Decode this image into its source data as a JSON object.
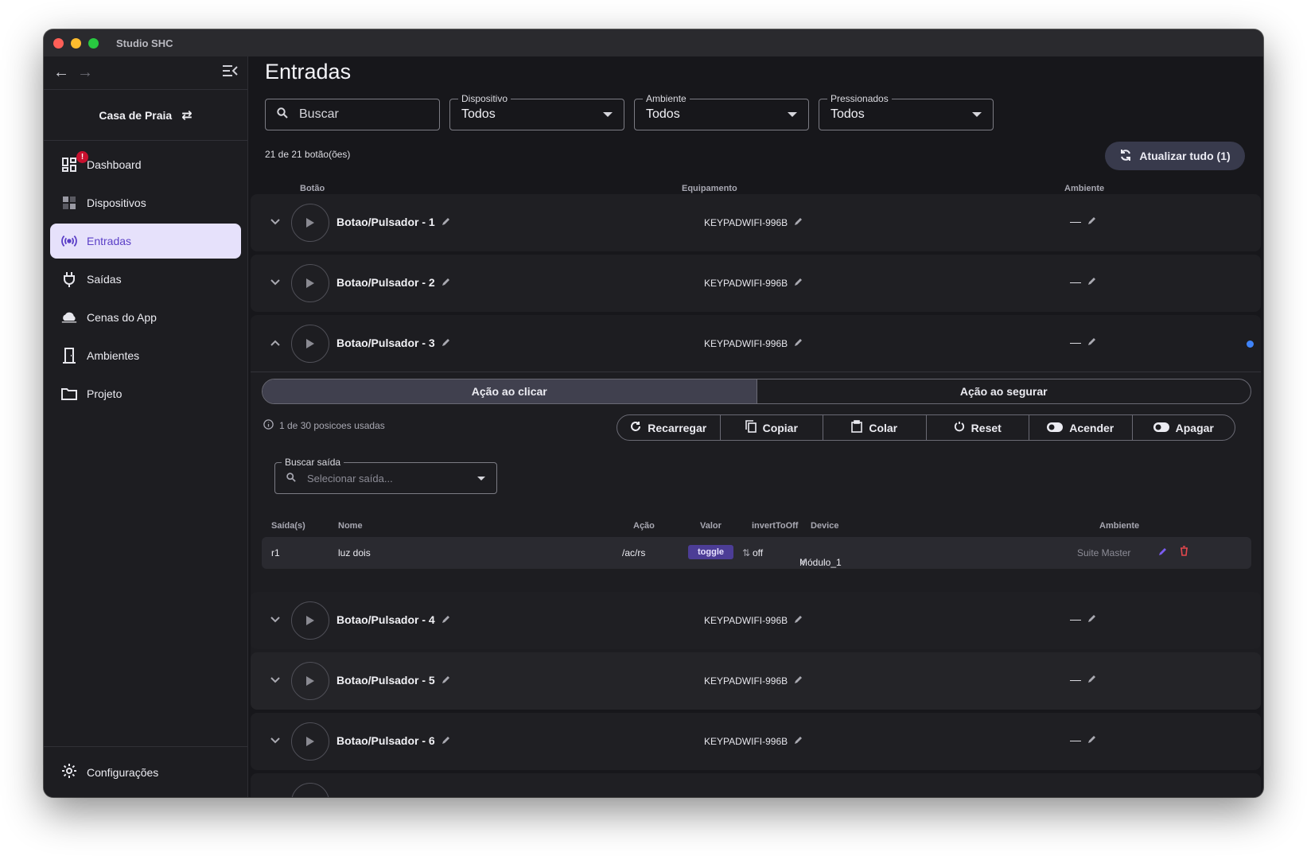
{
  "window": {
    "title": "Studio SHC"
  },
  "sidebar": {
    "house": "Casa de Praia",
    "items": [
      {
        "label": "Dashboard",
        "icon": "dashboard-icon",
        "badge": "!"
      },
      {
        "label": "Dispositivos",
        "icon": "devices-icon"
      },
      {
        "label": "Entradas",
        "icon": "broadcast-icon",
        "active": true
      },
      {
        "label": "Saídas",
        "icon": "plug-icon"
      },
      {
        "label": "Cenas do App",
        "icon": "cloud-icon"
      },
      {
        "label": "Ambientes",
        "icon": "door-icon"
      },
      {
        "label": "Projeto",
        "icon": "folder-icon"
      }
    ],
    "settings": "Configurações"
  },
  "main": {
    "title": "Entradas",
    "search_placeholder": "Buscar",
    "filters": [
      {
        "label": "Dispositivo",
        "value": "Todos"
      },
      {
        "label": "Ambiente",
        "value": "Todos"
      },
      {
        "label": "Pressionados",
        "value": "Todos"
      }
    ],
    "count": "21 de 21 botão(ões)",
    "refresh_label": "Atualizar tudo (1)",
    "columns": {
      "button": "Botão",
      "equipment": "Equipamento",
      "ambient": "Ambiente"
    },
    "rows": [
      {
        "name": "Botao/Pulsador - 1",
        "equipment": "KEYPADWIFI-996B",
        "ambient": "—"
      },
      {
        "name": "Botao/Pulsador - 2",
        "equipment": "KEYPADWIFI-996B",
        "ambient": "—"
      },
      {
        "name": "Botao/Pulsador - 3",
        "equipment": "KEYPADWIFI-996B",
        "ambient": "—"
      },
      {
        "name": "Botao/Pulsador - 4",
        "equipment": "KEYPADWIFI-996B",
        "ambient": "—"
      },
      {
        "name": "Botao/Pulsador - 5",
        "equipment": "KEYPADWIFI-996B",
        "ambient": "—"
      },
      {
        "name": "Botao/Pulsador - 6",
        "equipment": "KEYPADWIFI-996B",
        "ambient": "—"
      }
    ],
    "expanded": {
      "tab_click": "Ação ao clicar",
      "tab_hold": "Ação ao segurar",
      "used": "1 de 30 posicoes usadas",
      "actions": [
        "Recarregar",
        "Copiar",
        "Colar",
        "Reset",
        "Acender",
        "Apagar"
      ],
      "out_search_label": "Buscar saída",
      "out_search_placeholder": "Selecionar saída...",
      "out_columns": [
        "Saída(s)",
        "Nome",
        "Ação",
        "Valor",
        "invertToOff",
        "Device",
        "Ambiente"
      ],
      "out_row": {
        "output": "r1",
        "name": "luz dois",
        "action": "/ac/rs",
        "value": "toggle",
        "invert": "off",
        "device": "Módulo_1",
        "ambient": "Suite Master"
      }
    }
  },
  "colors": {
    "accent": "#5b3fc7",
    "active_bg": "#e6e1fb",
    "tag": "#4c3d96",
    "status": "#3f83f8",
    "delete": "#e5484d"
  }
}
